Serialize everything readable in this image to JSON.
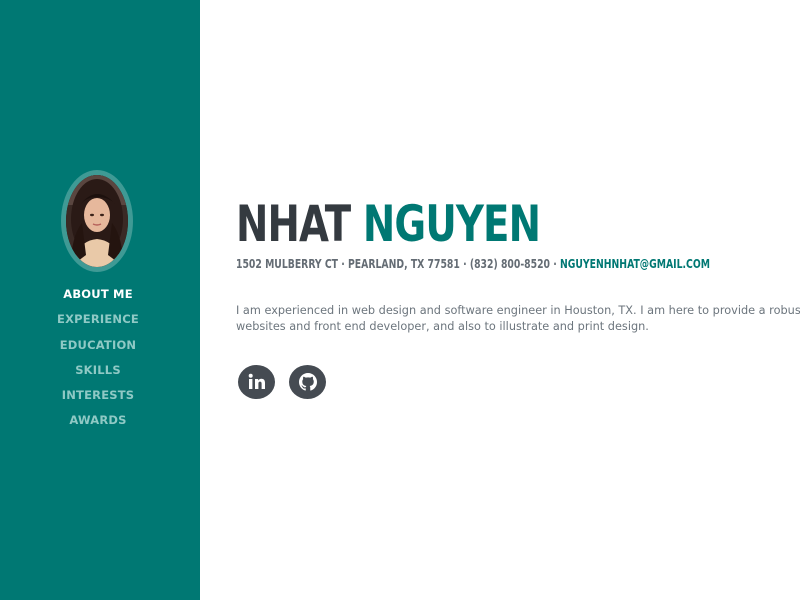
{
  "sidebar": {
    "background_color": "#007873",
    "avatar_icon": "profile-photo",
    "nav": [
      {
        "label": "ABOUT ME",
        "active": true
      },
      {
        "label": "EXPERIENCE",
        "active": false
      },
      {
        "label": "EDUCATION",
        "active": false
      },
      {
        "label": "SKILLS",
        "active": false
      },
      {
        "label": "INTERESTS",
        "active": false
      },
      {
        "label": "AWARDS",
        "active": false
      }
    ]
  },
  "main": {
    "name_first": "NHAT",
    "name_last": "NGUYEN",
    "contact_address": "1502 MULBERRY CT · PEARLAND, TX 77581 · (832) 800-8520 · ",
    "contact_email": "NGUYENHNHAT@GMAIL.COM",
    "bio_line1": "I am experienced in web design and software engineer in Houston, TX. I am here to provide a robust",
    "bio_line2": "websites and front end developer, and also to illustrate and print design.",
    "social": [
      {
        "icon": "linkedin-icon"
      },
      {
        "icon": "github-icon"
      }
    ]
  },
  "colors": {
    "accent": "#007873",
    "heading": "#343a40",
    "muted": "#6c757d",
    "nav_inactive": "#8fc9c5",
    "social_bg": "#454b52"
  }
}
